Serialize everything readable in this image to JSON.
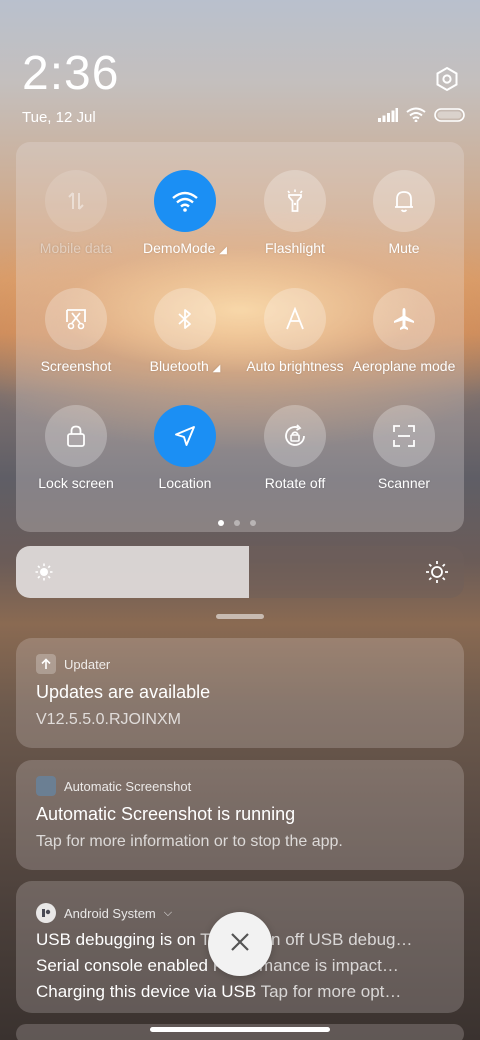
{
  "status": {
    "time": "2:36",
    "date": "Tue, 12 Jul"
  },
  "tiles": [
    {
      "label": "Mobile data",
      "icon": "mobile-data-icon",
      "state": "disabled"
    },
    {
      "label": "DemoMode",
      "icon": "wifi-icon",
      "state": "on",
      "expandable": true
    },
    {
      "label": "Flashlight",
      "icon": "flashlight-icon",
      "state": "off"
    },
    {
      "label": "Mute",
      "icon": "bell-icon",
      "state": "off"
    },
    {
      "label": "Screenshot",
      "icon": "screenshot-icon",
      "state": "off"
    },
    {
      "label": "Bluetooth",
      "icon": "bluetooth-icon",
      "state": "off",
      "expandable": true
    },
    {
      "label": "Auto brightness",
      "icon": "auto-brightness-icon",
      "state": "off"
    },
    {
      "label": "Aeroplane mode",
      "icon": "airplane-icon",
      "state": "off"
    },
    {
      "label": "Lock screen",
      "icon": "lock-icon",
      "state": "off"
    },
    {
      "label": "Location",
      "icon": "location-icon",
      "state": "on"
    },
    {
      "label": "Rotate off",
      "icon": "rotate-lock-icon",
      "state": "off"
    },
    {
      "label": "Scanner",
      "icon": "scanner-icon",
      "state": "off"
    }
  ],
  "pager": {
    "pages": 3,
    "active": 0
  },
  "brightness": {
    "level": 0.52
  },
  "notifications": [
    {
      "app": "Updater",
      "title": "Updates are available",
      "text": "V12.5.5.0.RJOINXM"
    },
    {
      "app": "Automatic Screenshot",
      "title": "Automatic Screenshot is running",
      "text": "Tap for more information or to stop the app."
    },
    {
      "app": "Android System",
      "lines": [
        {
          "title": "USB debugging is on",
          "text": "Tap to turn off USB debug…"
        },
        {
          "title": "Serial console enabled",
          "text": "Performance is impact…"
        },
        {
          "title": "Charging this device via USB",
          "text": "Tap for more opt…"
        }
      ]
    }
  ],
  "colors": {
    "accent": "#1b8ff4"
  }
}
